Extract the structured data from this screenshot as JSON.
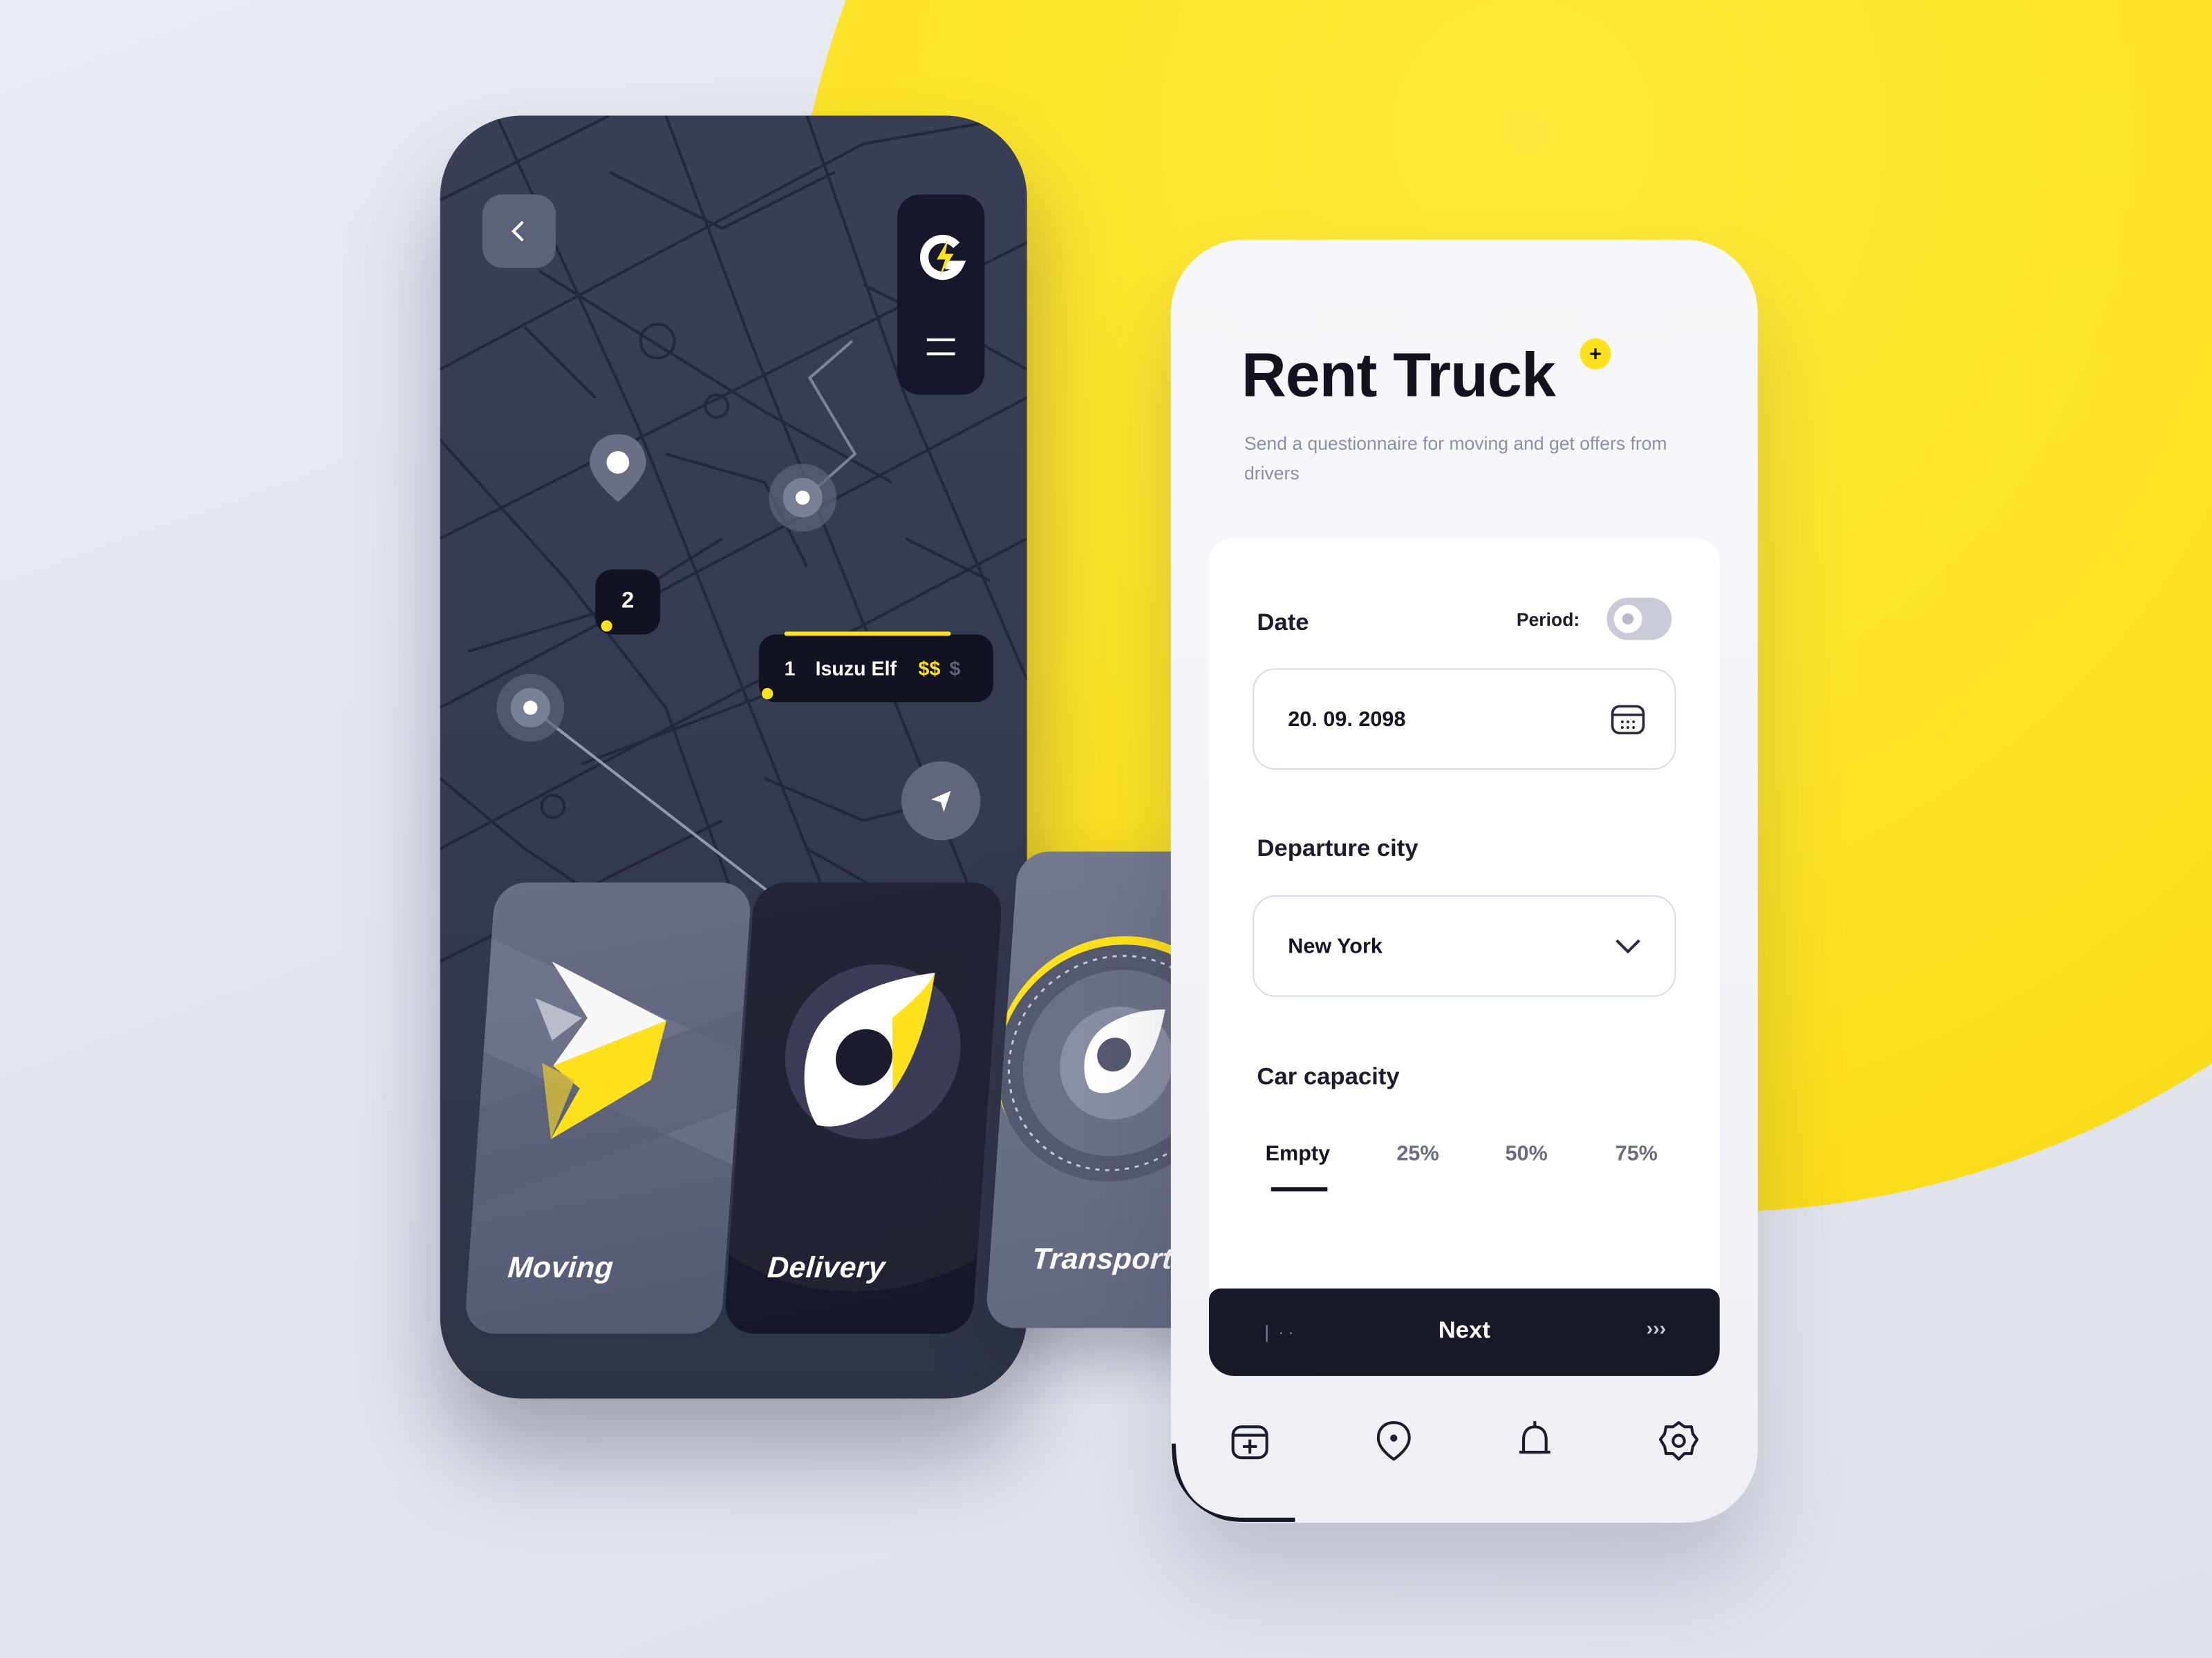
{
  "map_screen": {
    "route_badge_count": "2",
    "route_card": {
      "index": "1",
      "vehicle": "Isuzu Elf",
      "price_active": "$$",
      "price_inactive": "$"
    },
    "services": [
      {
        "label": "Moving"
      },
      {
        "label": "Delivery"
      },
      {
        "label": "Transport"
      }
    ]
  },
  "form_screen": {
    "title": "Rent Truck",
    "title_badge": "+",
    "subtitle": "Send a questionnaire for moving and get offers from drivers",
    "date": {
      "label": "Date",
      "period_label": "Period:",
      "value": "20. 09. 2098"
    },
    "departure": {
      "label": "Departure city",
      "value": "New York"
    },
    "capacity": {
      "label": "Car capacity",
      "options": [
        "Empty",
        "25%",
        "50%",
        "75%"
      ],
      "selected": "Empty"
    },
    "next_button": {
      "label": "Next"
    }
  },
  "colors": {
    "accent": "#ffe21b",
    "dark": "#171828",
    "map_bg": "#3a3f56"
  },
  "icons": [
    "back-arrow-icon",
    "logo-bolt-icon",
    "menu-icon",
    "location-pin-icon",
    "navigate-arrow-icon",
    "calendar-icon",
    "chevron-down-icon",
    "calendar-plus-icon",
    "bell-icon",
    "settings-icon"
  ]
}
